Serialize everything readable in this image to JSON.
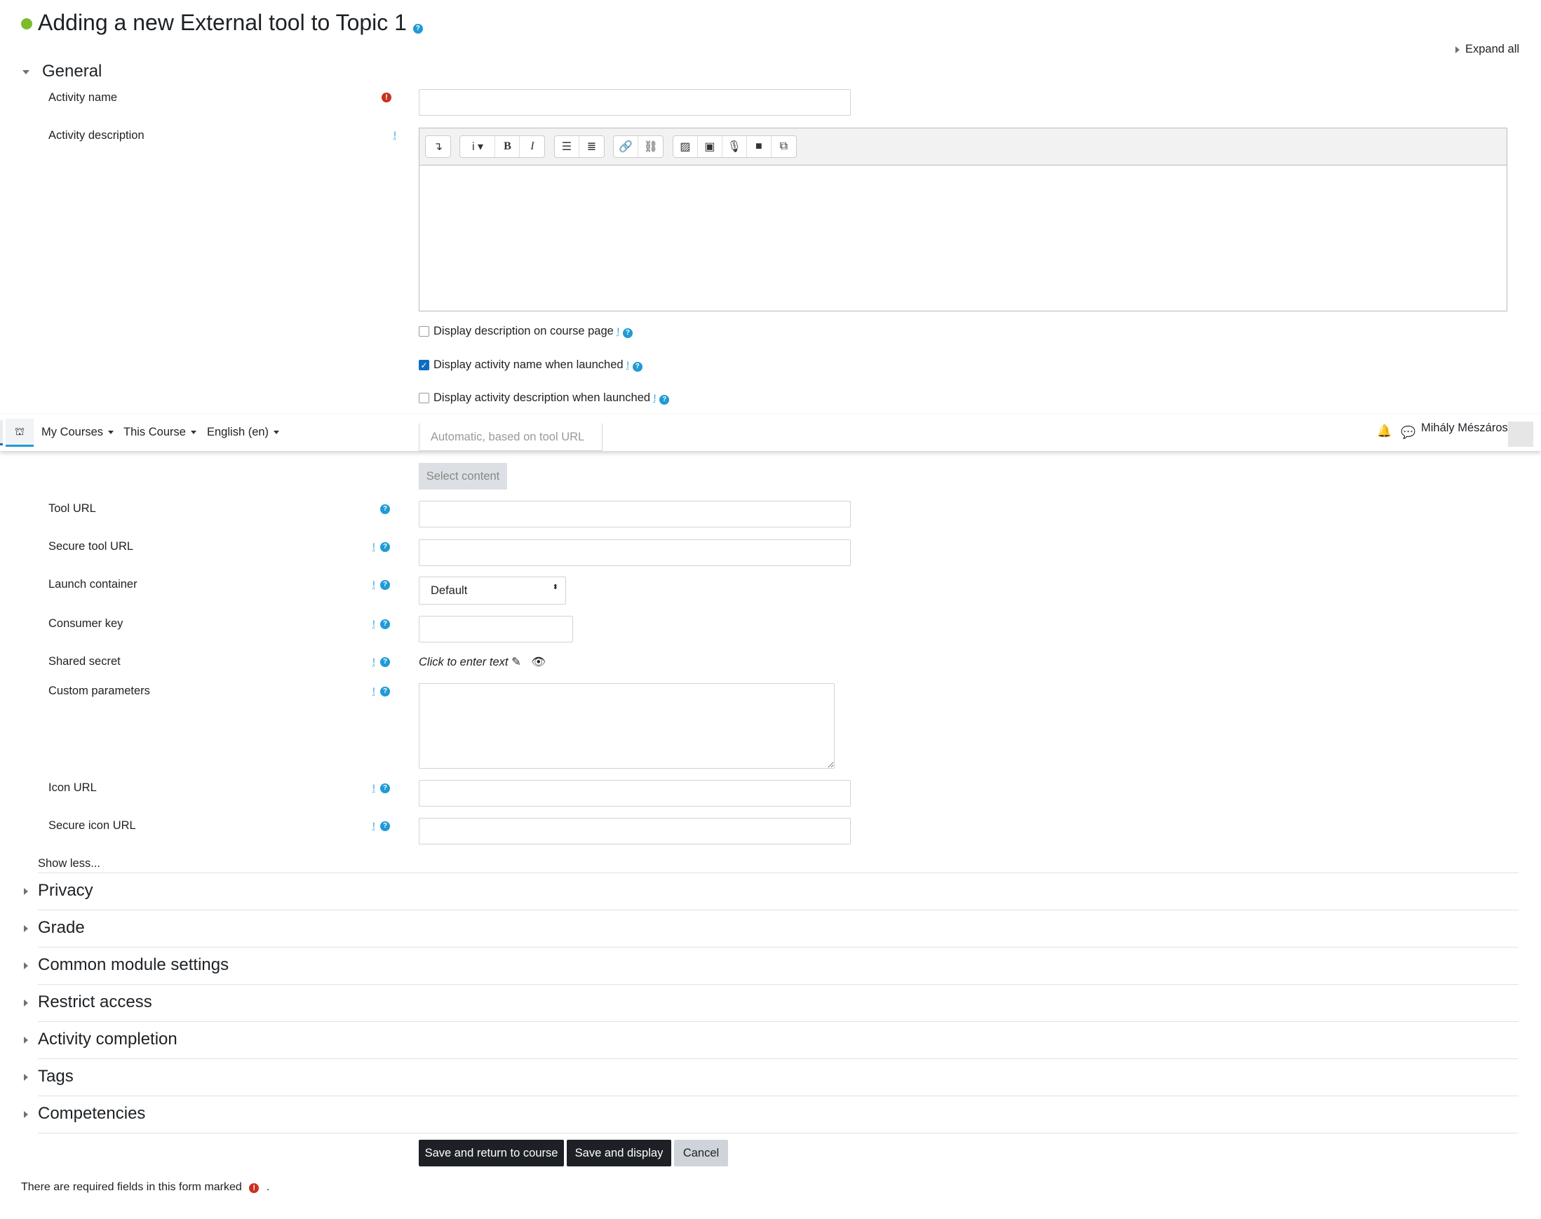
{
  "page": {
    "title": "Adding a new External tool to Topic 1",
    "expand_all": "Expand all"
  },
  "general": {
    "header": "General",
    "activity_name": {
      "label": "Activity name",
      "value": ""
    },
    "activity_description": {
      "label": "Activity description",
      "value": ""
    },
    "checkboxes": [
      {
        "label": "Display description on course page",
        "checked": false
      },
      {
        "label": "Display activity name when launched",
        "checked": true
      },
      {
        "label": "Display activity description when launched",
        "checked": false
      }
    ],
    "preconfigured_select": "Automatic, based on tool URL",
    "select_content": "Select content",
    "tool_url": {
      "label": "Tool URL",
      "value": ""
    },
    "secure_tool_url": {
      "label": "Secure tool URL",
      "value": ""
    },
    "launch_container": {
      "label": "Launch container",
      "value": "Default"
    },
    "consumer_key": {
      "label": "Consumer key",
      "value": ""
    },
    "shared_secret": {
      "label": "Shared secret",
      "value": "Click to enter text"
    },
    "custom_parameters": {
      "label": "Custom parameters",
      "value": ""
    },
    "icon_url": {
      "label": "Icon URL",
      "value": ""
    },
    "secure_icon_url": {
      "label": "Secure icon URL",
      "value": ""
    },
    "show_less": "Show less..."
  },
  "sections": [
    "Privacy",
    "Grade",
    "Common module settings",
    "Restrict access",
    "Activity completion",
    "Tags",
    "Competencies"
  ],
  "buttons": {
    "save_return": "Save and return to course",
    "save_display": "Save and display",
    "cancel": "Cancel"
  },
  "footer": {
    "required_note": "There are required fields in this form marked",
    "period": "."
  },
  "navbar": {
    "my_courses": "My Courses",
    "this_course": "This Course",
    "language": "English (en)",
    "user_name": "Mihály Mészáros"
  },
  "colors": {
    "accent": "#0f6cbf",
    "help": "#1f9bd6",
    "required": "#ca3120",
    "dark_button": "#1d2125"
  }
}
